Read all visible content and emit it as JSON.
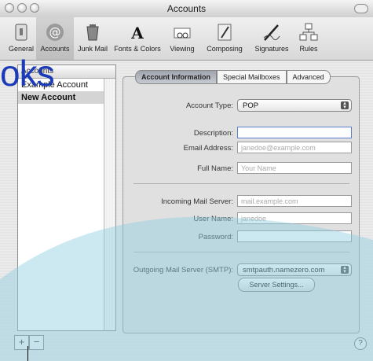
{
  "window": {
    "title": "Accounts"
  },
  "toolbar": {
    "items": [
      {
        "label": "General",
        "icon": "switch-icon"
      },
      {
        "label": "Accounts",
        "icon": "at-sign-icon"
      },
      {
        "label": "Junk Mail",
        "icon": "trash-bag-icon"
      },
      {
        "label": "Fonts & Colors",
        "icon": "font-icon"
      },
      {
        "label": "Viewing",
        "icon": "glasses-icon"
      },
      {
        "label": "Composing",
        "icon": "pencil-icon"
      },
      {
        "label": "Signatures",
        "icon": "pen-icon"
      },
      {
        "label": "Rules",
        "icon": "rules-icon"
      }
    ],
    "selected": "Accounts"
  },
  "accounts_list": {
    "header": "Accounts",
    "items": [
      "Example Account",
      "New Account"
    ],
    "selected": "New Account"
  },
  "tabs": [
    "Account Information",
    "Special Mailboxes",
    "Advanced"
  ],
  "form": {
    "account_type_label": "Account Type:",
    "account_type_value": "POP",
    "description_label": "Description:",
    "description_value": "",
    "email_label": "Email Address:",
    "email_placeholder": "janedoe@example.com",
    "fullname_label": "Full Name:",
    "fullname_placeholder": "Your Name",
    "incoming_label": "Incoming Mail Server:",
    "incoming_placeholder": "mail.example.com",
    "username_label": "User Name:",
    "username_placeholder": "janedoe",
    "password_label": "Password:",
    "smtp_label": "Outgoing Mail Server (SMTP):",
    "smtp_value": "smtpauth.namezero.com",
    "server_settings_label": "Server Settings..."
  },
  "buttons": {
    "add": "+",
    "remove": "−",
    "help": "?"
  },
  "overlay": {
    "logo_text": "oks",
    "color": "#1a3ab8"
  }
}
